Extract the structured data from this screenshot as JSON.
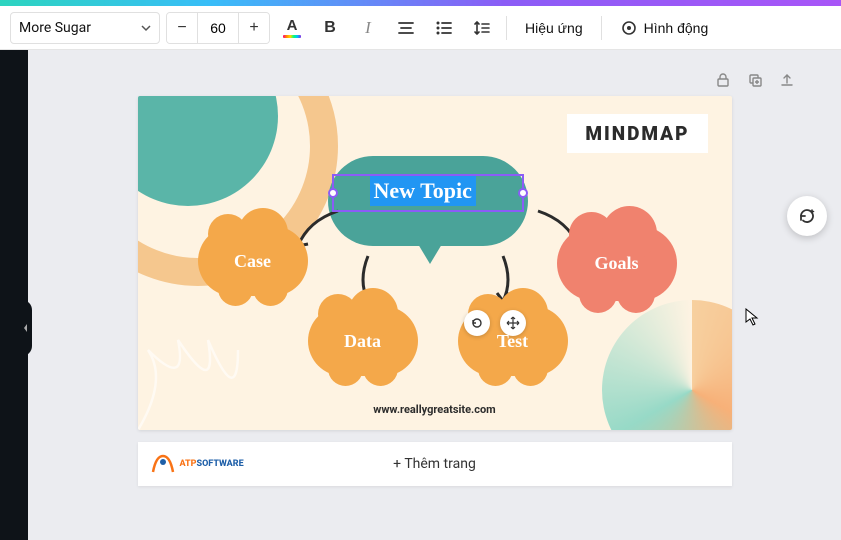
{
  "toolbar": {
    "font_name": "More Sugar",
    "font_size": "60",
    "effects_label": "Hiệu ứng",
    "animate_label": "Hình động"
  },
  "slide": {
    "label": "MINDMAP",
    "topic": "New Topic",
    "nodes": {
      "case": "Case",
      "goals": "Goals",
      "data": "Data",
      "test": "Test"
    },
    "footer_url": "www.reallygreatsite.com"
  },
  "add_page_label": "+ Thêm trang",
  "logo": {
    "line1": "ATP",
    "line2": "SOFTWARE"
  }
}
